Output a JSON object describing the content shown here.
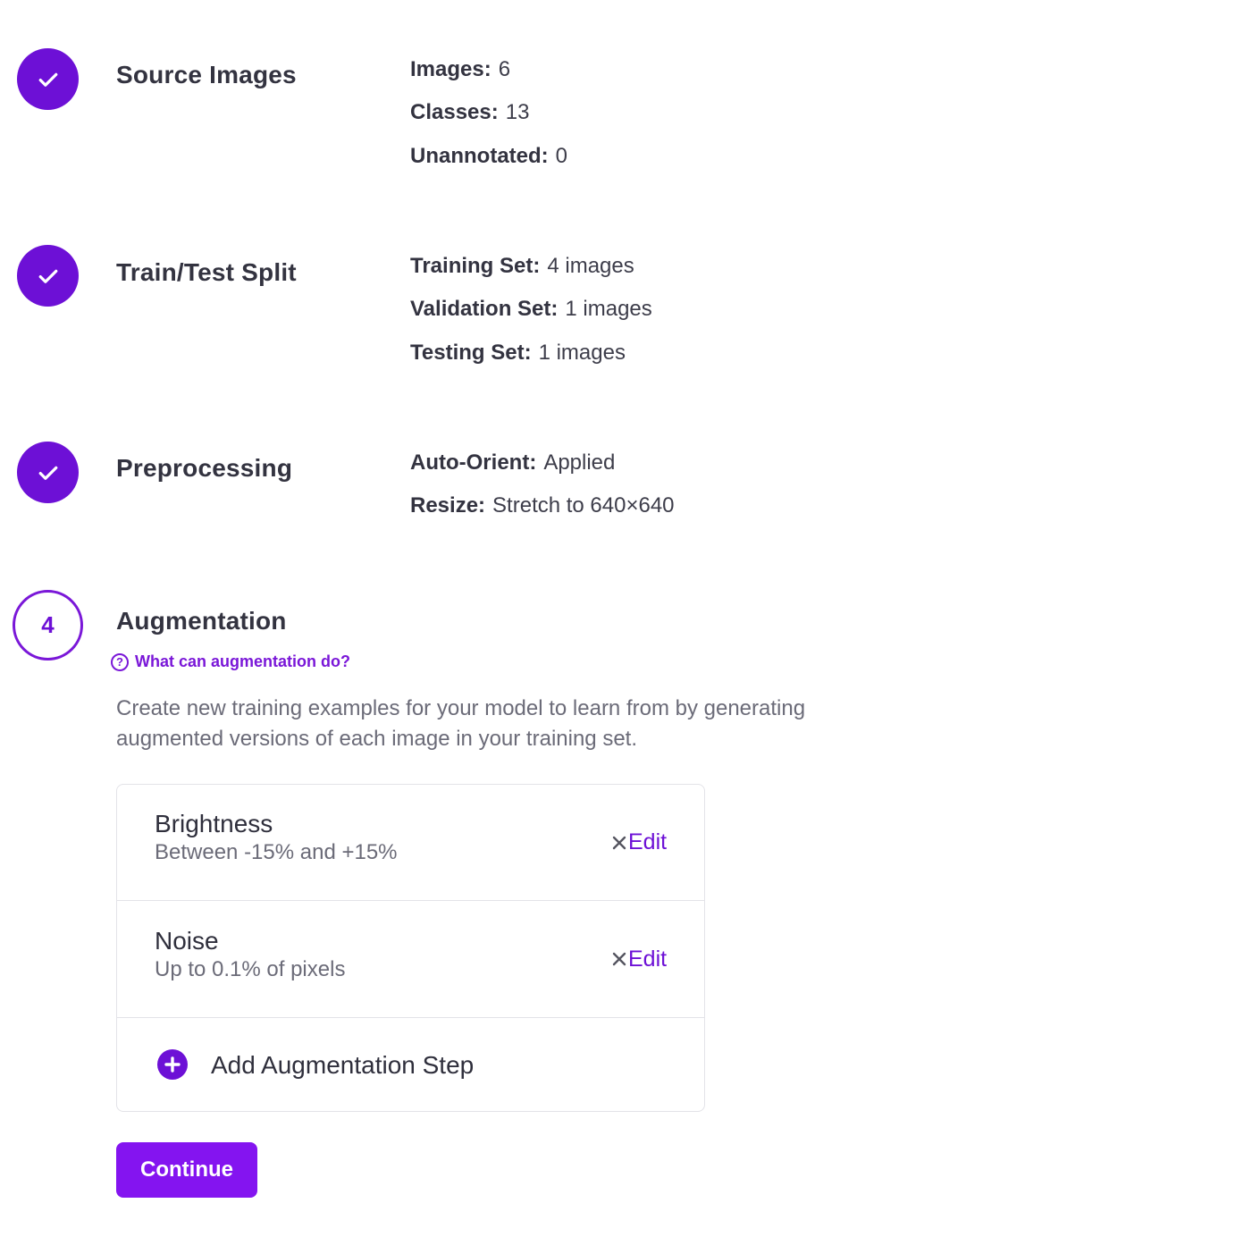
{
  "steps": [
    {
      "title": "Source Images",
      "status": "complete",
      "details": [
        {
          "key": "Images:",
          "value": "6"
        },
        {
          "key": "Classes:",
          "value": "13"
        },
        {
          "key": "Unannotated:",
          "value": "0"
        }
      ]
    },
    {
      "title": "Train/Test Split",
      "status": "complete",
      "details": [
        {
          "key": "Training Set:",
          "value": "4 images"
        },
        {
          "key": "Validation Set:",
          "value": "1 images"
        },
        {
          "key": "Testing Set:",
          "value": "1 images"
        }
      ]
    },
    {
      "title": "Preprocessing",
      "status": "complete",
      "details": [
        {
          "key": "Auto-Orient:",
          "value": "Applied"
        },
        {
          "key": "Resize:",
          "value": "Stretch to 640×640"
        }
      ]
    },
    {
      "number": "4",
      "title": "Augmentation",
      "status": "current",
      "help_link": "What can augmentation do?",
      "description": "Create new training examples for your model to learn from by generating augmented versions of each image in your training set.",
      "augmentations": [
        {
          "name": "Brightness",
          "detail": "Between -15% and +15%",
          "edit_label": "Edit"
        },
        {
          "name": "Noise",
          "detail": "Up to 0.1% of pixels",
          "edit_label": "Edit"
        }
      ],
      "add_label": "Add Augmentation Step"
    }
  ],
  "continue_label": "Continue",
  "colors": {
    "accent": "#6d10d6",
    "button": "#8414f0",
    "text": "#333340",
    "muted": "#6b6b78"
  },
  "icons": {
    "complete": "check-icon",
    "help": "question-circle-icon",
    "remove": "close-icon",
    "add": "plus-circle-icon"
  }
}
